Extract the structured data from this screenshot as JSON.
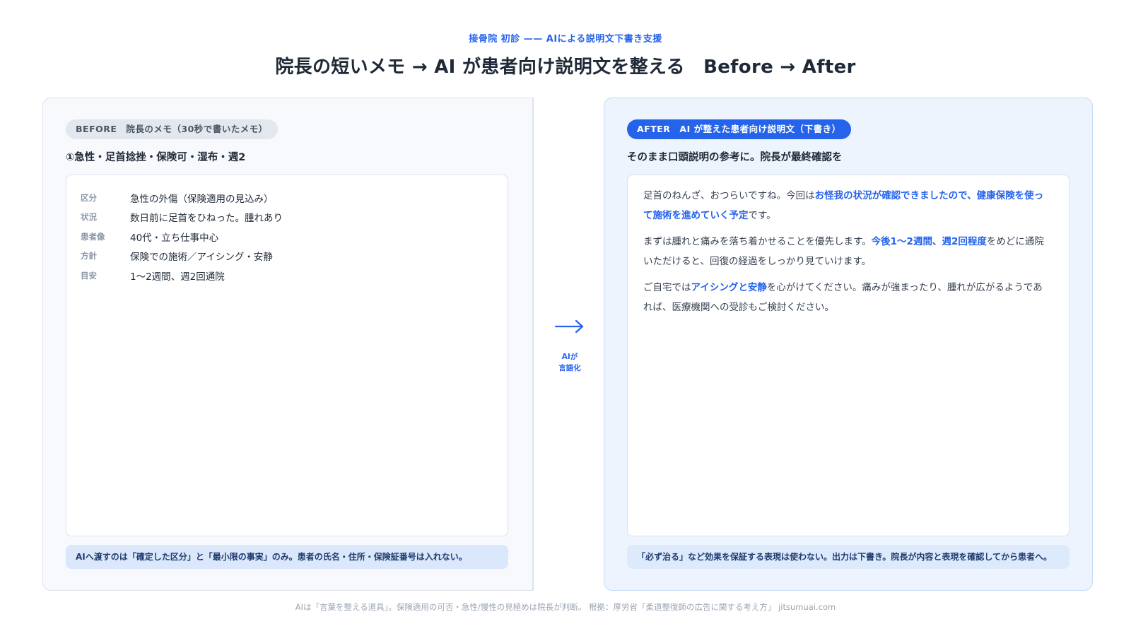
{
  "header": {
    "eyebrow": "接骨院 初診 —— AIによる説明文下書き支援",
    "title": "院長の短いメモ → AI が患者向け説明文を整える　Before → After"
  },
  "before": {
    "pill": "BEFORE　院長のメモ（30秒で書いたメモ）",
    "subhead": "①急性・足首捻挫・保険可・湿布・週2",
    "memo": [
      {
        "key": "区分",
        "value": "急性の外傷（保険適用の見込み）"
      },
      {
        "key": "状況",
        "value": "数日前に足首をひねった。腫れあり"
      },
      {
        "key": "患者像",
        "value": "40代・立ち仕事中心"
      },
      {
        "key": "方針",
        "value": "保険での施術／アイシング・安静"
      },
      {
        "key": "目安",
        "value": "1〜2週間、週2回通院"
      }
    ],
    "note": "AIへ渡すのは「確定した区分」と「最小限の事実」のみ。患者の氏名・住所・保険証番号は入れない。"
  },
  "middle": {
    "arrow_icon": "right-arrow-icon",
    "caption_line1": "AIが",
    "caption_line2": "言語化"
  },
  "after": {
    "pill": "AFTER　AI が整えた患者向け説明文（下書き）",
    "subhead": "そのまま口頭説明の参考に。院長が最終確認を",
    "p1": {
      "a": "足首のねんざ、おつらいですね。今回は",
      "b": "お怪我の状況が確認できましたので、健康保険を使って施術を進めていく予定",
      "c": "です。"
    },
    "p2": {
      "a": "まずは腫れと痛みを落ち着かせることを優先します。",
      "b": "今後1〜2週間、週2回程度",
      "c": "をめどに通院いただけると、回復の経過をしっかり見ていけます。"
    },
    "p3": {
      "a": "ご自宅では",
      "b": "アイシングと安静",
      "c": "を心がけてください。痛みが強まったり、腫れが広がるようであれば、医療機関への受診もご検討ください。"
    },
    "note": "「必ず治る」など効果を保証する表現は使わない。出力は下書き。院長が内容と表現を確認してから患者へ。"
  },
  "footer": {
    "text": "AIは「言葉を整える道具」。保険適用の可否・急性/慢性の見極めは院長が判断。 根拠：厚労省「柔道整復師の広告に関する考え方」 jitsumuai.com"
  },
  "colors": {
    "accent": "#2563eb",
    "before_bg": "#f7f9fc",
    "after_bg": "#edf4fe"
  }
}
